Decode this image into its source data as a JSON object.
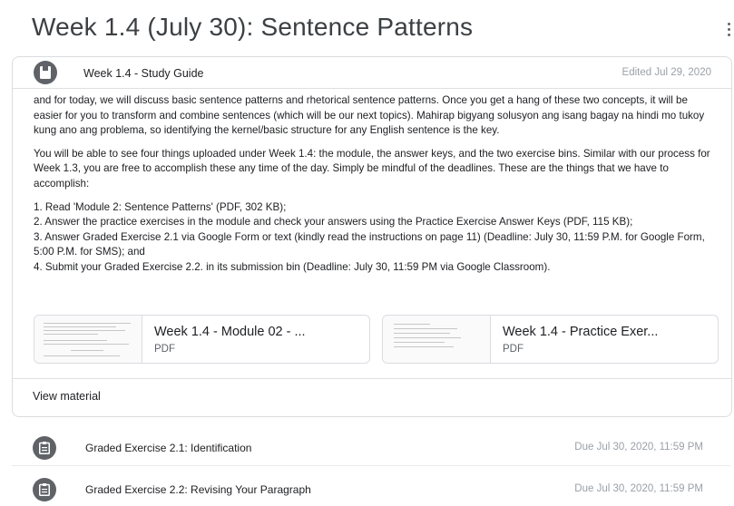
{
  "page": {
    "title": "Week 1.4 (July 30): Sentence Patterns",
    "more_icon": "more-vert-icon"
  },
  "material": {
    "icon": "book-icon",
    "title": "Week 1.4 - Study Guide",
    "edited": "Edited Jul 29, 2020",
    "paragraphs": [
      "and for today, we will discuss basic sentence patterns and rhetorical sentence patterns. Once you get a hang of these two concepts, it will be easier for you to transform and combine sentences (which will be our next topics). Mahirap bigyang solusyon ang isang bagay na hindi mo tukoy kung ano ang problema, so identifying the kernel/basic structure for any English sentence is the key.",
      "You will be able to see four things uploaded under Week 1.4: the module, the answer keys, and the two exercise bins. Similar with our process for Week 1.3, you are free to accomplish these any time of the day. Simply be mindful of the deadlines. These are the things that we have to accomplish:"
    ],
    "tasks": [
      "1. Read 'Module 2: Sentence Patterns' (PDF, 302 KB);",
      "2. Answer the practice exercises in the module and check your answers using the Practice Exercise Answer Keys (PDF, 115 KB);",
      "3. Answer Graded Exercise 2.1 via Google Form or text (kindly read the instructions on page 11) (Deadline: July 30, 11:59 P.M. for Google Form, 5:00 P.M. for SMS); and",
      "4. Submit your Graded Exercise 2.2. in its submission bin (Deadline: July 30, 11:59 PM via Google Classroom)."
    ],
    "attachments": [
      {
        "title": "Week 1.4 - Module 02 - ...",
        "type": "PDF"
      },
      {
        "title": "Week 1.4 - Practice Exer...",
        "type": "PDF"
      }
    ],
    "view_label": "View material"
  },
  "assignments": [
    {
      "icon": "assignment-icon",
      "title": "Graded Exercise 2.1: Identification",
      "due": "Due Jul 30, 2020, 11:59 PM"
    },
    {
      "icon": "assignment-icon",
      "title": "Graded Exercise 2.2: Revising Your Paragraph",
      "due": "Due Jul 30, 2020, 11:59 PM"
    }
  ],
  "colors": {
    "icon_bg": "#5f6368",
    "border": "#dadce0",
    "muted_text": "#9aa0a6"
  }
}
